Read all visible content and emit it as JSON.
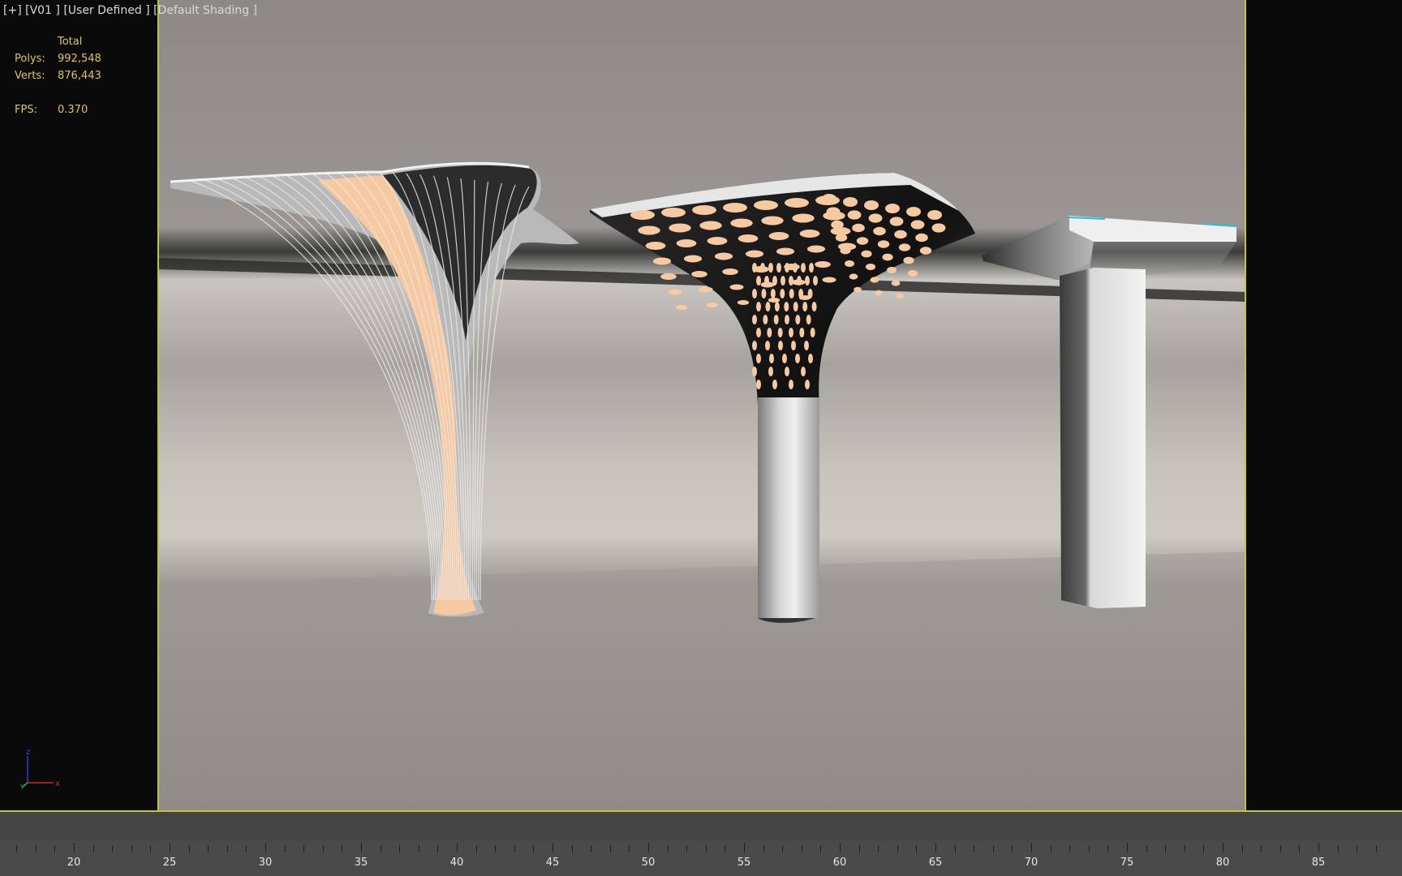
{
  "viewport": {
    "label": "[+] [V01 ] [User Defined ] [Default Shading ]"
  },
  "stats": {
    "header": "Total",
    "polys_label": "Polys:",
    "polys_value": "992,548",
    "verts_label": "Verts:",
    "verts_value": "876,443",
    "fps_label": "FPS:",
    "fps_value": "0.370"
  },
  "axis_gizmo": {
    "z": "z",
    "y": "y",
    "x": "x"
  },
  "timeline": {
    "labels": [
      "20",
      "25",
      "30",
      "35",
      "40",
      "45",
      "50",
      "55",
      "60",
      "65",
      "70",
      "75",
      "80",
      "85"
    ]
  },
  "colors": {
    "frame_accent": "#c8c23a",
    "stats_text": "#e0c848",
    "glow": "#f6c9a0"
  }
}
